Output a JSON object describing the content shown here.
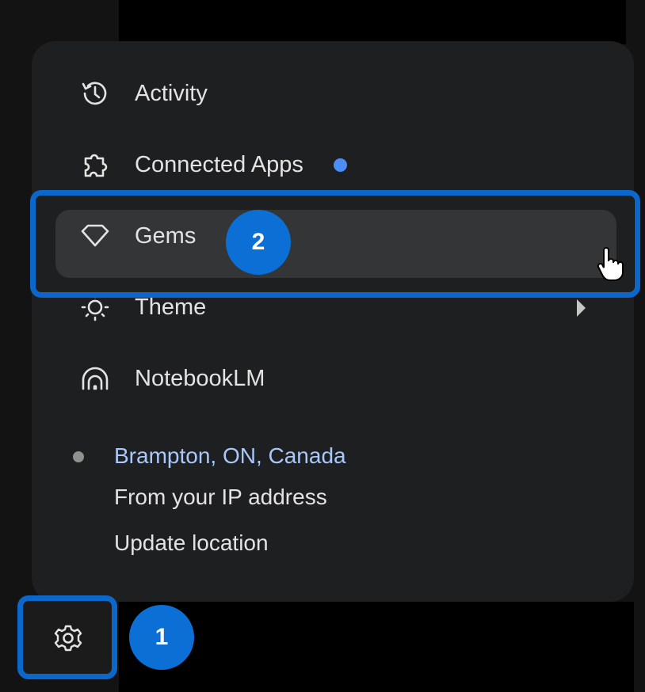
{
  "menu": {
    "items": [
      {
        "label": "Activity",
        "icon": "history-icon"
      },
      {
        "label": "Connected Apps",
        "icon": "puzzle-icon",
        "has_notification_dot": true
      },
      {
        "label": "Gems",
        "icon": "gem-icon",
        "hovered": true
      },
      {
        "label": "Theme",
        "icon": "theme-icon",
        "has_submenu": true
      },
      {
        "label": "NotebookLM",
        "icon": "notebooklm-icon"
      }
    ],
    "location": {
      "city": "Brampton, ON, Canada",
      "source": "From your IP address",
      "update_label": "Update location"
    }
  },
  "annotations": {
    "step1": "1",
    "step2": "2",
    "highlight_color": "#0b67c9"
  },
  "settings_button": {
    "icon": "gear-icon"
  },
  "colors": {
    "accent_blue": "#4c8df6",
    "link_blue": "#a8c7fa",
    "panel_bg": "#1e1f20"
  }
}
